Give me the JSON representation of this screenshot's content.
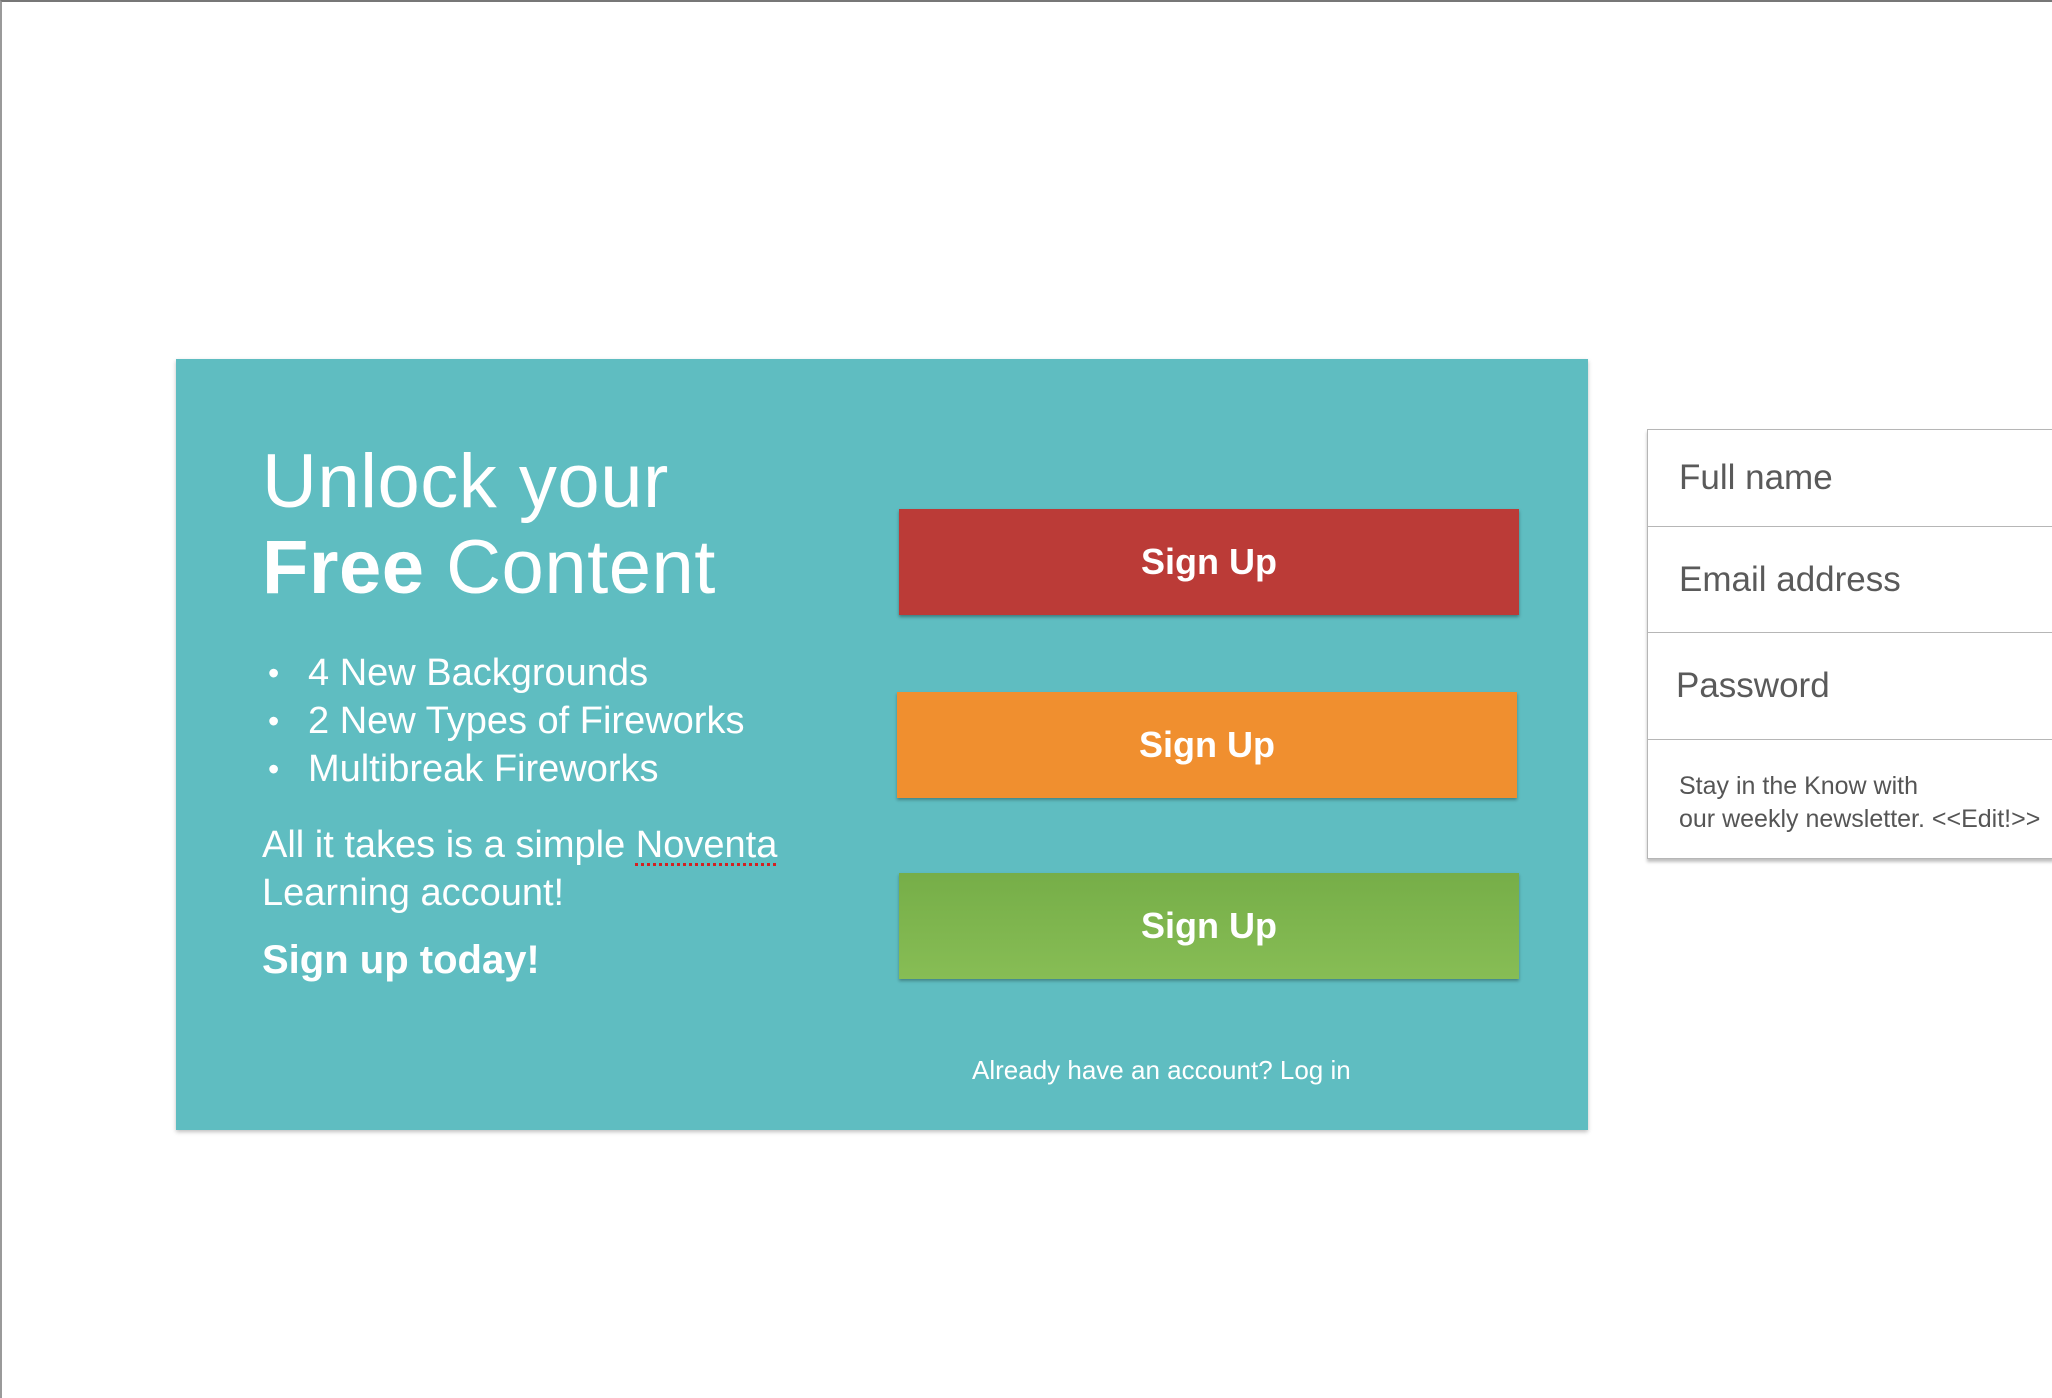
{
  "headline": {
    "line1": "Unlock your",
    "line2_bold": "Free",
    "line2_rest": " Content"
  },
  "benefits": [
    "4 New Backgrounds",
    "2 New Types of Fireworks",
    "Multibreak Fireworks"
  ],
  "blurb": {
    "before_brand": "All it takes is a simple ",
    "brand": "Noventa",
    "after_brand": " Learning account!"
  },
  "cta_text": "Sign up today!",
  "buttons": {
    "red": "Sign Up",
    "orange": "Sign Up",
    "green": "Sign Up"
  },
  "login_link": "Already have an account? Log in",
  "form": {
    "full_name_placeholder": "Full name",
    "email_placeholder": "Email address",
    "password_placeholder": "Password",
    "newsletter_line1": "Stay in the Know with",
    "newsletter_line2": "our weekly newsletter. <<Edit!>>"
  },
  "colors": {
    "card_background": "#5fbdc1",
    "button_red": "#bb3b37",
    "button_orange": "#f08f2f",
    "button_green": "#7cb34c"
  }
}
